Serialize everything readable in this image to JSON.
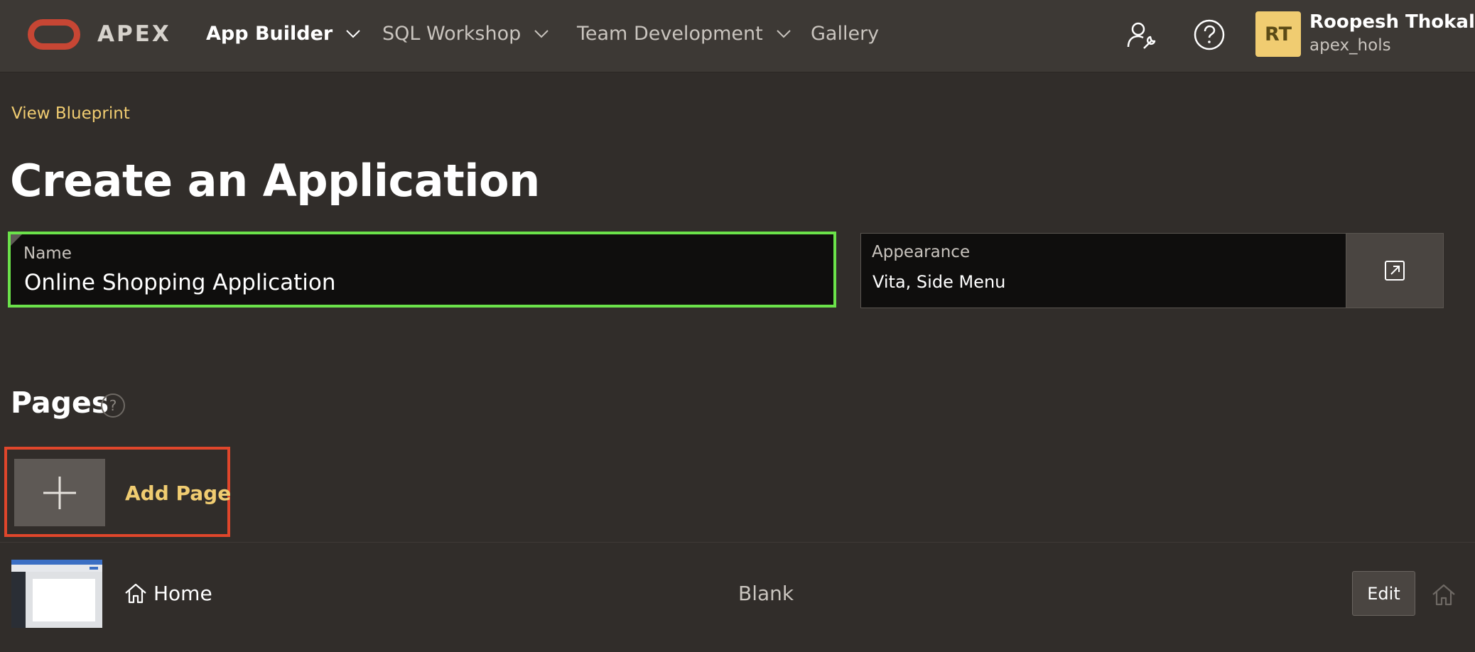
{
  "topbar": {
    "brand": "APEX",
    "nav": [
      {
        "label": "App Builder",
        "has_menu": true,
        "active": true
      },
      {
        "label": "SQL Workshop",
        "has_menu": true,
        "active": false
      },
      {
        "label": "Team Development",
        "has_menu": true,
        "active": false
      },
      {
        "label": "Gallery",
        "has_menu": false,
        "active": false
      }
    ],
    "icons": [
      "administration-icon",
      "help-icon"
    ],
    "user": {
      "initials": "RT",
      "name": "Roopesh Thokala",
      "workspace": "apex_hols"
    }
  },
  "blueprint_link": "View Blueprint",
  "title": "Create an Application",
  "name_field": {
    "label": "Name",
    "value": "Online Shopping Application"
  },
  "appearance_field": {
    "label": "Appearance",
    "value": "Vita, Side Menu",
    "button_icon": "open-dialog-icon"
  },
  "pages_section": {
    "title": "Pages",
    "help_symbol": "?",
    "add_page_label": "Add Page",
    "rows": [
      {
        "name": "Home",
        "type": "Blank",
        "edit_label": "Edit"
      }
    ]
  },
  "colors": {
    "background": "#312d2a",
    "topbar": "#3d3935",
    "accent_yellow": "#f0cc71",
    "highlight_green": "#6be24a",
    "highlight_red": "#e0462b",
    "oracle_red": "#c74634"
  }
}
